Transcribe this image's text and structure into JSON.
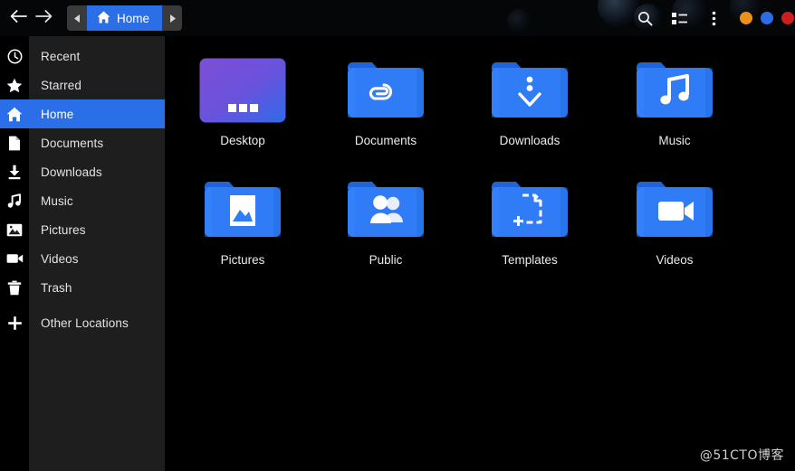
{
  "window": {
    "title": "Home",
    "controls": [
      {
        "name": "minimize",
        "color": "#e8921a"
      },
      {
        "name": "maximize",
        "color": "#2d6ce8"
      },
      {
        "name": "close",
        "color": "#cc1e1e"
      }
    ]
  },
  "header": {
    "back_label": "←",
    "forward_label": "→",
    "breadcrumb": {
      "prev_label": "◀",
      "next_label": "▶",
      "current": "Home",
      "current_icon": "home-icon",
      "accent": "#2a6fe8"
    },
    "actions": [
      {
        "id": "search",
        "icon": "search-icon",
        "label": "Search"
      },
      {
        "id": "view-list",
        "icon": "list-view-icon",
        "label": "List view"
      },
      {
        "id": "menu",
        "icon": "three-dots-vertical-icon",
        "label": "Menu"
      }
    ]
  },
  "sidebar": {
    "selected": "Home",
    "items": [
      {
        "label": "Recent",
        "icon": "clock-icon"
      },
      {
        "label": "Starred",
        "icon": "star-icon"
      },
      {
        "label": "Home",
        "icon": "home-icon"
      },
      {
        "label": "Documents",
        "icon": "document-icon"
      },
      {
        "label": "Downloads",
        "icon": "download-icon"
      },
      {
        "label": "Music",
        "icon": "music-note-icon"
      },
      {
        "label": "Pictures",
        "icon": "image-icon"
      },
      {
        "label": "Videos",
        "icon": "video-camera-icon"
      },
      {
        "label": "Trash",
        "icon": "trash-icon"
      },
      {
        "label": "Other Locations",
        "icon": "plus-icon"
      }
    ]
  },
  "main": {
    "items": [
      {
        "label": "Desktop",
        "icon": "desktop-gradient-icon",
        "type": "desktop"
      },
      {
        "label": "Documents",
        "icon": "folder-paperclip-icon",
        "type": "folder"
      },
      {
        "label": "Downloads",
        "icon": "folder-download-icon",
        "type": "folder"
      },
      {
        "label": "Music",
        "icon": "folder-music-icon",
        "type": "folder"
      },
      {
        "label": "Pictures",
        "icon": "folder-picture-icon",
        "type": "folder"
      },
      {
        "label": "Public",
        "icon": "folder-people-icon",
        "type": "folder"
      },
      {
        "label": "Templates",
        "icon": "folder-template-icon",
        "type": "folder"
      },
      {
        "label": "Videos",
        "icon": "folder-video-icon",
        "type": "folder"
      }
    ]
  },
  "watermark": "@51CTO博客",
  "colors": {
    "accent": "#2a6fe8",
    "folder": "#2f7cf6",
    "folder_dark": "#1f64d8",
    "sidebar_bg": "#1e1e1e",
    "content_bg": "#000000"
  }
}
